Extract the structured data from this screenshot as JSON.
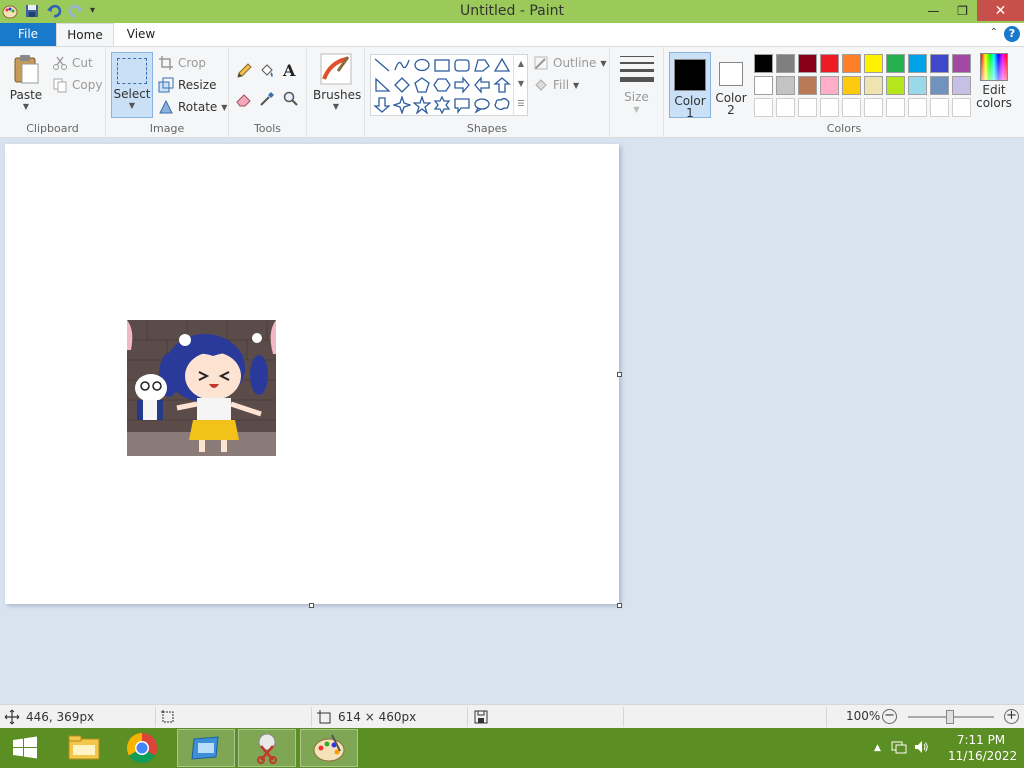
{
  "window": {
    "title": "Untitled - Paint",
    "minimize": "—",
    "maximize": "❐",
    "close": "✕"
  },
  "tabs": {
    "file": "File",
    "home": "Home",
    "view": "View",
    "help": "?"
  },
  "ribbon": {
    "clipboard": {
      "label": "Clipboard",
      "paste": "Paste",
      "cut": "Cut",
      "copy": "Copy"
    },
    "image": {
      "label": "Image",
      "select": "Select",
      "crop": "Crop",
      "resize": "Resize",
      "rotate": "Rotate"
    },
    "tools": {
      "label": "Tools",
      "text_glyph": "A"
    },
    "brushes": {
      "label": "Brushes"
    },
    "shapes": {
      "label": "Shapes",
      "outline": "Outline",
      "fill": "Fill"
    },
    "size": {
      "label": "Size"
    },
    "colors": {
      "label": "Colors",
      "color1": "Color",
      "color1_num": "1",
      "color2": "Color",
      "color2_num": "2",
      "edit_colors_1": "Edit",
      "edit_colors_2": "colors",
      "color1_value": "#000000",
      "color2_value": "#ffffff",
      "palette": [
        "#000000",
        "#7f7f7f",
        "#880015",
        "#ed1c24",
        "#ff7f27",
        "#fff200",
        "#22b14c",
        "#00a2e8",
        "#3f48cc",
        "#a349a4",
        "#ffffff",
        "#c3c3c3",
        "#b97a57",
        "#ffaec9",
        "#ffc90e",
        "#efe4b0",
        "#b5e61d",
        "#99d9ea",
        "#7092be",
        "#c8bfe7",
        "#ffffff",
        "#ffffff",
        "#ffffff",
        "#ffffff",
        "#ffffff",
        "#ffffff",
        "#ffffff",
        "#ffffff",
        "#ffffff",
        "#ffffff"
      ]
    }
  },
  "status": {
    "cursor_pos": "446, 369px",
    "selection_size": "",
    "canvas_size": "614 × 460px",
    "zoom": "100%",
    "zoom_minus": "−",
    "zoom_plus": "+"
  },
  "taskbar": {
    "time": "7:11 PM",
    "date": "11/16/2022"
  },
  "colors_theme": {
    "titlebar": "#9bc95a",
    "file_tab": "#1979ca",
    "taskbar": "#5b8e23",
    "workspace": "#d9e2ef"
  }
}
